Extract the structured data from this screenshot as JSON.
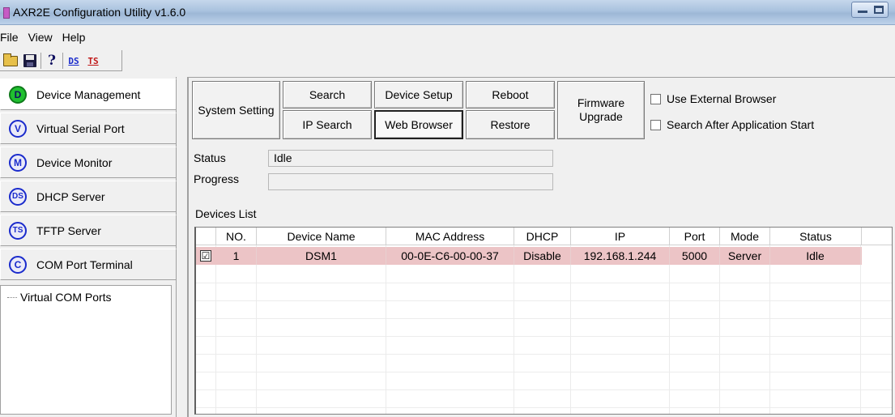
{
  "window": {
    "title": "AXR2E Configuration Utility v1.6.0"
  },
  "menu": [
    "File",
    "View",
    "Help"
  ],
  "toolbar": {
    "ds_label": "DS",
    "ts_label": "TS"
  },
  "nav": [
    {
      "badge": "D",
      "label": "Device Management"
    },
    {
      "badge": "V",
      "label": "Virtual Serial Port"
    },
    {
      "badge": "M",
      "label": "Device Monitor"
    },
    {
      "badge": "DS",
      "label": "DHCP Server"
    },
    {
      "badge": "TS",
      "label": "TFTP Server"
    },
    {
      "badge": "C",
      "label": "COM Port Terminal"
    }
  ],
  "tree": {
    "item": "Virtual COM Ports"
  },
  "buttons": {
    "system_setting": "System Setting",
    "search": "Search",
    "ip_search": "IP Search",
    "device_setup": "Device Setup",
    "web_browser": "Web Browser",
    "reboot": "Reboot",
    "restore": "Restore",
    "firmware_upgrade": "Firmware Upgrade"
  },
  "options": {
    "use_external_browser": "Use External Browser",
    "search_after_start": "Search After Application Start"
  },
  "status": {
    "status_label": "Status",
    "status_value": "Idle",
    "progress_label": "Progress",
    "progress_value": 0
  },
  "devices": {
    "title": "Devices List",
    "columns": [
      "NO.",
      "Device Name",
      "MAC Address",
      "DHCP",
      "IP",
      "Port",
      "Mode",
      "Status"
    ],
    "rows": [
      {
        "checked": true,
        "check_glyph": "☑",
        "no": "1",
        "name": "DSM1",
        "mac": "00-0E-C6-00-00-37",
        "dhcp": "Disable",
        "ip": "192.168.1.244",
        "port": "5000",
        "mode": "Server",
        "status": "Idle"
      }
    ]
  },
  "colors": {
    "selected_row": "#ecc4c6",
    "badge_active": "#20c030",
    "badge_border": "#1a2bcc"
  }
}
